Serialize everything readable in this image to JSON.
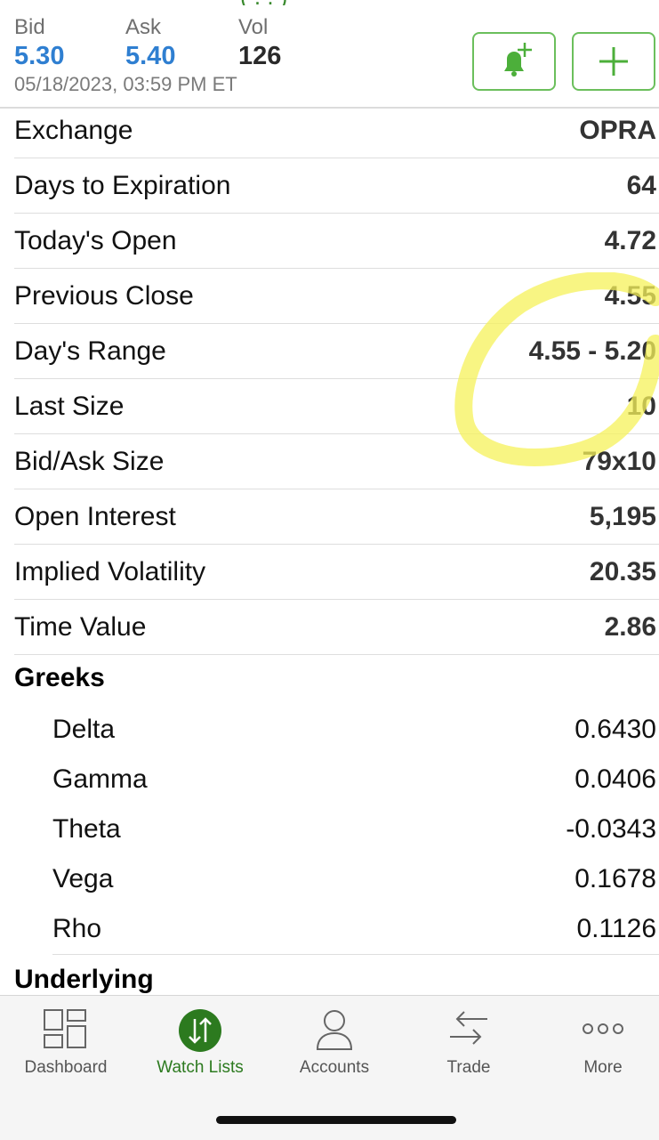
{
  "quote": {
    "bid_label": "Bid",
    "bid_value": "5.30",
    "ask_label": "Ask",
    "ask_value": "5.40",
    "vol_label": "Vol",
    "vol_value": "126",
    "timestamp": "05/18/2023, 03:59 PM ET",
    "accent_color": "#6bbf5c"
  },
  "details": [
    {
      "label": "Exchange",
      "value": "OPRA"
    },
    {
      "label": "Days to Expiration",
      "value": "64"
    },
    {
      "label": "Today's Open",
      "value": "4.72"
    },
    {
      "label": "Previous Close",
      "value": "4.55"
    },
    {
      "label": "Day's Range",
      "value": "4.55 - 5.20"
    },
    {
      "label": "Last Size",
      "value": "10"
    },
    {
      "label": "Bid/Ask Size",
      "value": "79x10"
    },
    {
      "label": "Open Interest",
      "value": "5,195"
    },
    {
      "label": "Implied Volatility",
      "value": "20.35"
    },
    {
      "label": "Time Value",
      "value": "2.86"
    }
  ],
  "greeks": {
    "title": "Greeks",
    "items": [
      {
        "label": "Delta",
        "value": "0.6430"
      },
      {
        "label": "Gamma",
        "value": "0.0406"
      },
      {
        "label": "Theta",
        "value": "-0.0343"
      },
      {
        "label": "Vega",
        "value": "0.1678"
      },
      {
        "label": "Rho",
        "value": "0.1126"
      }
    ]
  },
  "underlying": {
    "title": "Underlying"
  },
  "tabbar": {
    "tabs": [
      {
        "label": "Dashboard",
        "icon": "dashboard-icon",
        "active": false
      },
      {
        "label": "Watch Lists",
        "icon": "watch-lists-icon",
        "active": true
      },
      {
        "label": "Accounts",
        "icon": "accounts-icon",
        "active": false
      },
      {
        "label": "Trade",
        "icon": "trade-icon",
        "active": false
      },
      {
        "label": "More",
        "icon": "more-icon",
        "active": false
      }
    ],
    "active_color": "#2c7a1f"
  }
}
